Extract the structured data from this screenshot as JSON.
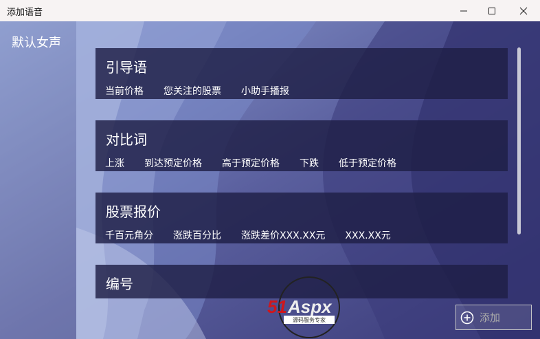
{
  "window": {
    "title": "添加语音"
  },
  "sidebar": {
    "items": [
      {
        "label": "默认女声"
      }
    ]
  },
  "cards": [
    {
      "heading": "引导语",
      "options": [
        "当前价格",
        "您关注的股票",
        "小助手播报"
      ]
    },
    {
      "heading": "对比词",
      "options": [
        "上涨",
        "到达预定价格",
        "高于预定价格",
        "下跌",
        "低于预定价格"
      ]
    },
    {
      "heading": "股票报价",
      "options": [
        "千百元角分",
        "涨跌百分比",
        "涨跌差价XXX.XX元",
        "XXX.XX元"
      ]
    },
    {
      "heading": "编号",
      "options": []
    }
  ],
  "add_button": {
    "label": "添加"
  },
  "watermark": {
    "brand": "51Aspx",
    "tagline": "源码服务专家"
  },
  "colors": {
    "background": "#4a4d8c",
    "card": "#1e1e46",
    "text": "#ffffff",
    "button_text": "#aaaaaa"
  }
}
